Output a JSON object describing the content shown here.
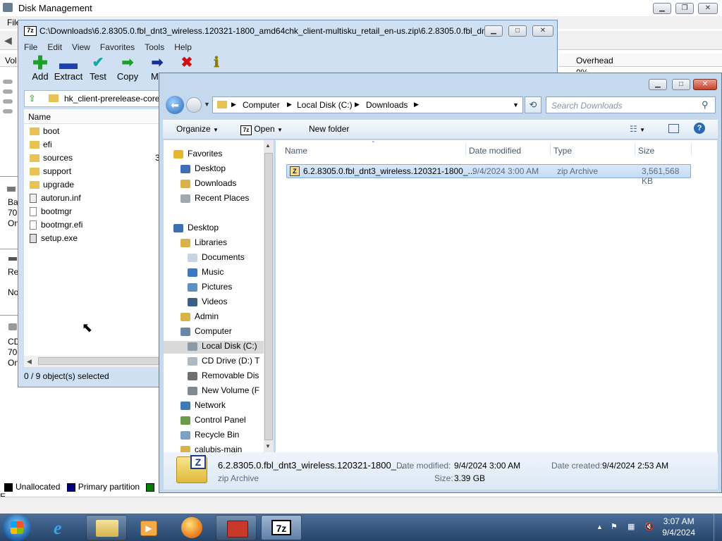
{
  "disk_mgmt": {
    "title": "Disk Management",
    "menu_first": "File",
    "col_left": "Vol",
    "col_overhead": "Overhead",
    "overhead_value": "0%",
    "left_fragments": [
      "Ba",
      "70.",
      "On",
      "Re",
      "No",
      "CD",
      "700",
      "On"
    ],
    "legend": [
      {
        "label": "Unallocated",
        "color": "#000000"
      },
      {
        "label": "Primary partition",
        "color": "#00007f"
      },
      {
        "label": "E",
        "color": "#008000"
      }
    ]
  },
  "zip": {
    "title": "C:\\Downloads\\6.2.8305.0.fbl_dnt3_wireless.120321-1800_amd64chk_client-multisku_retail_en-us.zip\\6.2.8305.0.fbl_dnt...",
    "menu": [
      "File",
      "Edit",
      "View",
      "Favorites",
      "Tools",
      "Help"
    ],
    "tools": [
      {
        "label": "Add",
        "icon": "plus-icon",
        "color": "#1f9e2a",
        "glyph": "+"
      },
      {
        "label": "Extract",
        "icon": "minus-icon",
        "color": "#1f3faa",
        "glyph": "—"
      },
      {
        "label": "Test",
        "icon": "checkmark-icon",
        "color": "#11a7a7",
        "glyph": "✓"
      },
      {
        "label": "Copy",
        "icon": "arrow-right-green-icon",
        "color": "#1f9e2a",
        "glyph": "➜"
      },
      {
        "label": "Mo",
        "icon": "arrow-right-blue-icon",
        "color": "#1a2e8f",
        "glyph": "➜"
      },
      {
        "label": "",
        "icon": "delete-x-icon",
        "color": "#d01010",
        "glyph": "✖"
      },
      {
        "label": "",
        "icon": "info-icon",
        "color": "#8a7a00",
        "glyph": "i"
      }
    ],
    "path": "hk_client-prerelease-core",
    "list_header": "Name",
    "items": [
      {
        "name": "boot",
        "type": "folder"
      },
      {
        "name": "efi",
        "type": "folder"
      },
      {
        "name": "sources",
        "type": "folder"
      },
      {
        "name": "support",
        "type": "folder"
      },
      {
        "name": "upgrade",
        "type": "folder"
      },
      {
        "name": "autorun.inf",
        "type": "file"
      },
      {
        "name": "bootmgr",
        "type": "file"
      },
      {
        "name": "bootmgr.efi",
        "type": "file"
      },
      {
        "name": "setup.exe",
        "type": "file"
      }
    ],
    "size_fragment": "3",
    "status": "0 / 9 object(s) selected"
  },
  "explorer": {
    "breadcrumb": [
      "Computer",
      "Local Disk (C:)",
      "Downloads"
    ],
    "search_placeholder": "Search Downloads",
    "cmd": {
      "organize": "Organize",
      "open": "Open",
      "new_folder": "New folder"
    },
    "tree": [
      {
        "label": "Favorites",
        "indent": 0,
        "icon": "star-icon",
        "color": "#e8b530"
      },
      {
        "label": "Desktop",
        "indent": 1,
        "icon": "desktop-icon",
        "color": "#3c6fb4"
      },
      {
        "label": "Downloads",
        "indent": 1,
        "icon": "downloads-folder-icon",
        "color": "#d8b24a"
      },
      {
        "label": "Recent Places",
        "indent": 1,
        "icon": "recent-places-icon",
        "color": "#a0a8b0"
      },
      {
        "label": "",
        "indent": 0,
        "icon": "",
        "color": ""
      },
      {
        "label": "Desktop",
        "indent": 0,
        "icon": "desktop-icon",
        "color": "#3c6fb4"
      },
      {
        "label": "Libraries",
        "indent": 1,
        "icon": "libraries-icon",
        "color": "#d8b24a"
      },
      {
        "label": "Documents",
        "indent": 2,
        "icon": "documents-icon",
        "color": "#c9d4e0"
      },
      {
        "label": "Music",
        "indent": 2,
        "icon": "music-icon",
        "color": "#3a78c6"
      },
      {
        "label": "Pictures",
        "indent": 2,
        "icon": "pictures-icon",
        "color": "#5e8fc4"
      },
      {
        "label": "Videos",
        "indent": 2,
        "icon": "videos-icon",
        "color": "#3a5e88"
      },
      {
        "label": "Admin",
        "indent": 1,
        "icon": "user-folder-icon",
        "color": "#d8b24a"
      },
      {
        "label": "Computer",
        "indent": 1,
        "icon": "computer-icon",
        "color": "#6b87a8"
      },
      {
        "label": "Local Disk (C:)",
        "indent": 2,
        "icon": "local-disk-icon",
        "color": "#8c9aa8",
        "selected": true
      },
      {
        "label": "CD Drive (D:) T",
        "indent": 2,
        "icon": "cd-drive-icon",
        "color": "#b0b8c0"
      },
      {
        "label": "Removable Dis",
        "indent": 2,
        "icon": "removable-disk-icon",
        "color": "#707070"
      },
      {
        "label": "New Volume (F",
        "indent": 2,
        "icon": "drive-icon",
        "color": "#808890"
      },
      {
        "label": "Network",
        "indent": 1,
        "icon": "network-icon",
        "color": "#3b7bb8"
      },
      {
        "label": "Control Panel",
        "indent": 1,
        "icon": "control-panel-icon",
        "color": "#6a9a4a"
      },
      {
        "label": "Recycle Bin",
        "indent": 1,
        "icon": "recycle-bin-icon",
        "color": "#7fa0c0"
      },
      {
        "label": "calubis-main",
        "indent": 1,
        "icon": "7zip-file-icon",
        "color": "#d8b24a"
      }
    ],
    "columns": {
      "name": "Name",
      "date": "Date modified",
      "type": "Type",
      "size": "Size"
    },
    "file": {
      "name": "6.2.8305.0.fbl_dnt3_wireless.120321-1800_...",
      "date": "9/4/2024 3:00 AM",
      "type": "zip Archive",
      "size": "3,561,568 KB"
    },
    "details": {
      "name": "6.2.8305.0.fbl_dnt3_wireless.120321-1800_...",
      "type": "zip Archive",
      "date_modified_label": "Date modified:",
      "date_modified": "9/4/2024 3:00 AM",
      "date_created_label": "Date created:",
      "date_created": "9/4/2024 2:53 AM",
      "size_label": "Size:",
      "size": "3.39 GB"
    }
  },
  "taskbar": {
    "time": "3:07 AM",
    "date": "9/4/2024"
  }
}
